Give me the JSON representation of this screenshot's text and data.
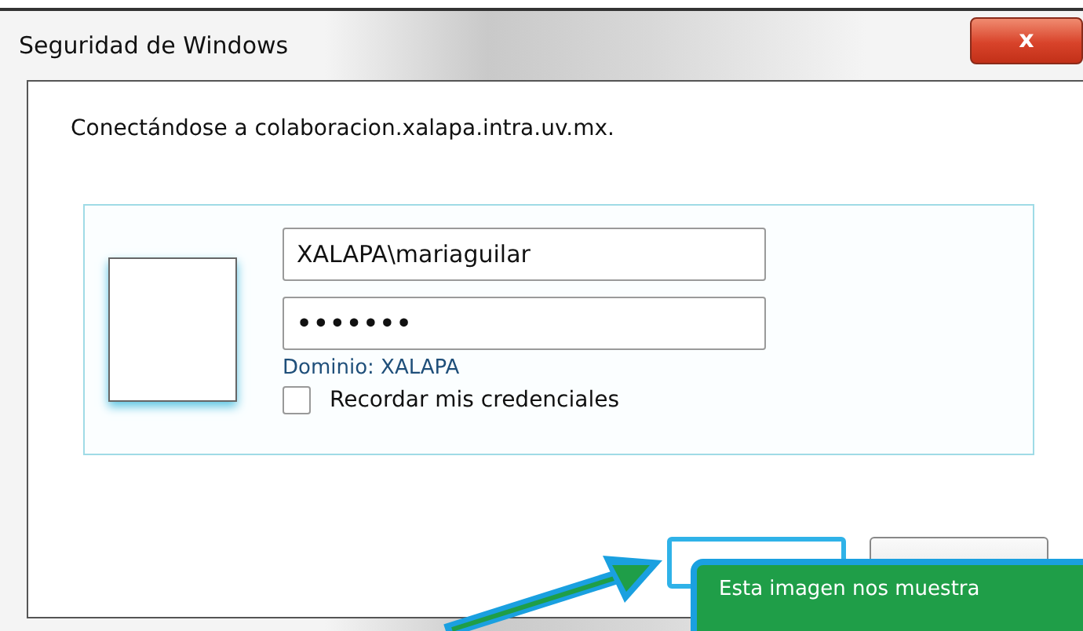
{
  "window": {
    "title": "Seguridad de Windows",
    "close": "x"
  },
  "message": "Conectándose a colaboracion.xalapa.intra.uv.mx.",
  "credential": {
    "username": "XALAPA\\mariaguilar",
    "password": "•••••••",
    "domain": "Dominio: XALAPA",
    "remember": {
      "label": "Recordar mis credenciales",
      "checked": false
    }
  },
  "buttons": [
    {
      "focused": true
    },
    {
      "focused": false
    }
  ],
  "callout": {
    "text": "Esta imagen nos muestra"
  }
}
